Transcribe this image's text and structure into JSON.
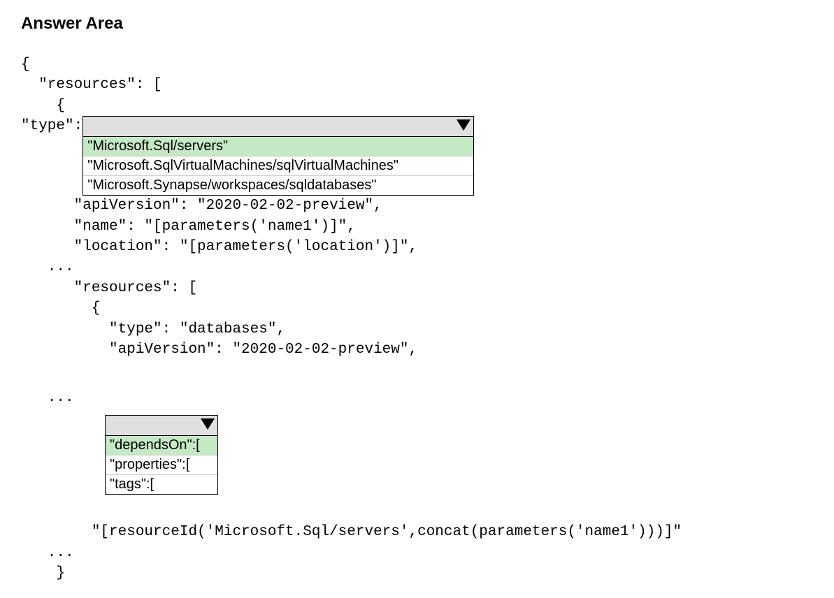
{
  "title": "Answer Area",
  "code": {
    "line1": "{",
    "line2": "  \"resources\": [",
    "line3": "    {",
    "line4_prefix": "      \"type\": ",
    "line5": "      \"apiVersion\": \"2020-02-02-preview\",",
    "line6": "      \"name\": \"[parameters('name1')]\",",
    "line7": "      \"location\": \"[parameters('location')]\",",
    "line8": "   ...",
    "line9": "      \"resources\": [",
    "line10": "        {",
    "line11": "          \"type\": \"databases\",",
    "line12": "          \"apiVersion\": \"2020-02-02-preview\",",
    "line13": "   ...",
    "line14": "        \"[resourceId('Microsoft.Sql/servers',concat(parameters('name1')))]\"",
    "line15": "   ...",
    "line16": "    }"
  },
  "dropdown1": {
    "options": [
      "\"Microsoft.Sql/servers\"",
      "\"Microsoft.SqlVirtualMachines/sqlVirtualMachines\"",
      "\"Microsoft.Synapse/workspaces/sqldatabases\""
    ],
    "selected_index": 0
  },
  "dropdown2": {
    "options": [
      "\"dependsOn\":[",
      "\"properties\":[",
      "\"tags\":["
    ],
    "selected_index": 0
  }
}
